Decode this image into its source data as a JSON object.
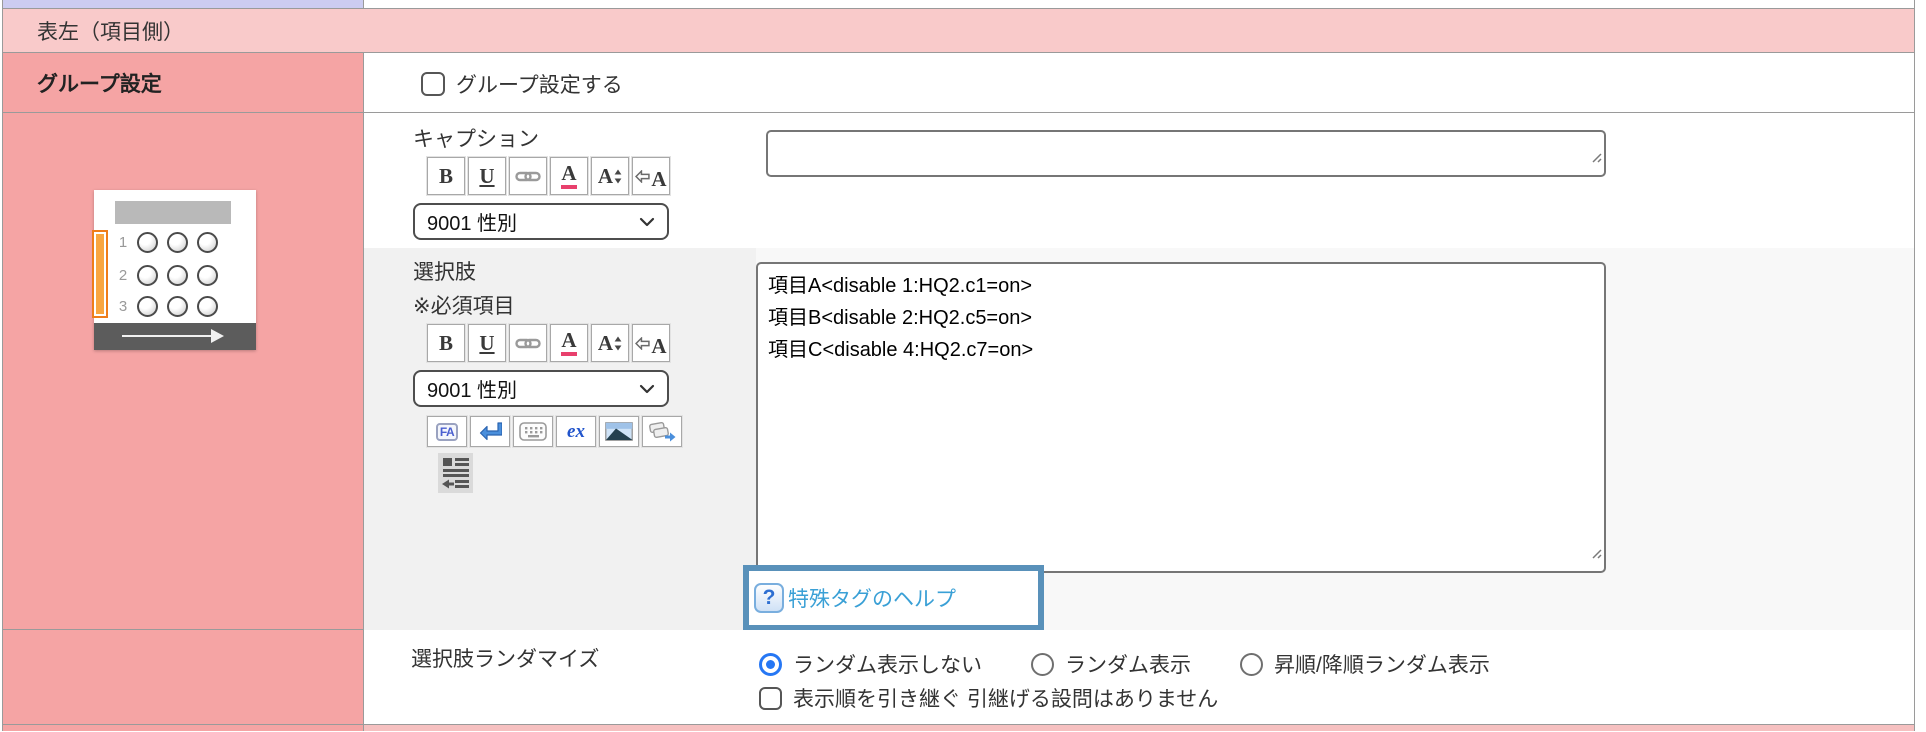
{
  "header": {
    "title": "表左（項目側）"
  },
  "group_row": {
    "label": "グループ設定",
    "checkbox_label": "グループ設定する"
  },
  "thumbnail": {
    "rows": [
      "1",
      "2",
      "3"
    ]
  },
  "format_toolbar": [
    {
      "name": "bold-icon",
      "glyph": "B"
    },
    {
      "name": "underline-icon",
      "glyph": "U"
    },
    {
      "name": "link-icon"
    },
    {
      "name": "font-color-icon",
      "glyph": "A"
    },
    {
      "name": "font-size-icon",
      "glyph": "A"
    },
    {
      "name": "ruby-icon",
      "glyph": "A"
    }
  ],
  "insert_toolbar": [
    {
      "name": "fa-parts-icon",
      "glyph": "FA"
    },
    {
      "name": "line-break-icon"
    },
    {
      "name": "keypad-icon"
    },
    {
      "name": "ex-answer-icon",
      "glyph": "ex"
    },
    {
      "name": "image-icon"
    },
    {
      "name": "copy-tags-icon"
    }
  ],
  "caption_section": {
    "label": "キャプション",
    "dropdown_value": "9001 性別",
    "input_value": ""
  },
  "choices_section": {
    "label": "選択肢",
    "required_note": "※必須項目",
    "dropdown_value": "9001 性別",
    "textarea_value": "項目A<disable 1:HQ2.c1=on>\n項目B<disable 2:HQ2.c5=on>\n項目C<disable 4:HQ2.c7=on>",
    "help_icon_glyph": "?",
    "help_link": "特殊タグのヘルプ"
  },
  "randomize_row": {
    "label": "選択肢ランダマイズ",
    "options": [
      {
        "label": "ランダム表示しない",
        "selected": true
      },
      {
        "label": "ランダム表示",
        "selected": false
      },
      {
        "label": "昇順/降順ランダム表示",
        "selected": false
      }
    ],
    "inherit_checkbox_label": "表示順を引き継ぐ 引継げる設問はありません"
  },
  "colors": {
    "header_pink": "#f9caca",
    "left_column_salmon": "#f5a4a4",
    "lavender_strip": "#ccccf1",
    "highlight_border_blue": "#5991ba",
    "link_blue": "#3aa0d6",
    "radio_selected_blue": "#2677f4",
    "column_highlight_orange": "#ef7d1a",
    "font_color_red": "#e8406d"
  }
}
